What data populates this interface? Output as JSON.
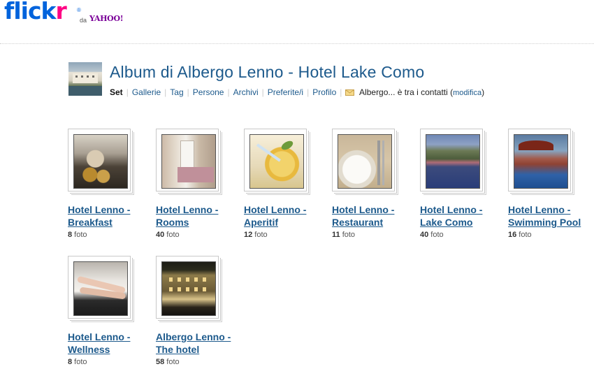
{
  "logo": {
    "text_main": "flick",
    "text_accent": "r",
    "registered": "®",
    "by": "da",
    "yahoo": "YAHOO!",
    "colors": {
      "blue": "#0063dc",
      "pink": "#ff0084",
      "yahoo": "#7b0099"
    }
  },
  "header": {
    "title": "Album di Albergo Lenno - Hotel Lake Como",
    "nav": {
      "current": "Set",
      "items": [
        "Gallerie",
        "Tag",
        "Persone",
        "Archivi",
        "Preferite/i",
        "Profilo"
      ],
      "contact_text": "Albergo... è tra i contatti (",
      "contact_link": "modifica",
      "contact_close": ")"
    }
  },
  "sets": [
    {
      "title": "Hotel Lenno - Breakfast",
      "count": "8",
      "unit": " foto",
      "icon": "photo-breakfast"
    },
    {
      "title": "Hotel Lenno - Rooms",
      "count": "40",
      "unit": " foto",
      "icon": "photo-rooms"
    },
    {
      "title": "Hotel Lenno - Aperitif",
      "count": "12",
      "unit": " foto",
      "icon": "photo-aperitif"
    },
    {
      "title": "Hotel Lenno - Restaurant",
      "count": "11",
      "unit": " foto",
      "icon": "photo-restaurant"
    },
    {
      "title": "Hotel Lenno - Lake Como",
      "count": "40",
      "unit": " foto",
      "icon": "photo-lake"
    },
    {
      "title": "Hotel Lenno - Swimming Pool",
      "count": "16",
      "unit": " foto",
      "icon": "photo-pool"
    },
    {
      "title": "Hotel Lenno - Wellness",
      "count": "8",
      "unit": " foto",
      "icon": "photo-wellness"
    },
    {
      "title": "Albergo Lenno - The hotel",
      "count": "58",
      "unit": " foto",
      "icon": "photo-hotel"
    }
  ]
}
